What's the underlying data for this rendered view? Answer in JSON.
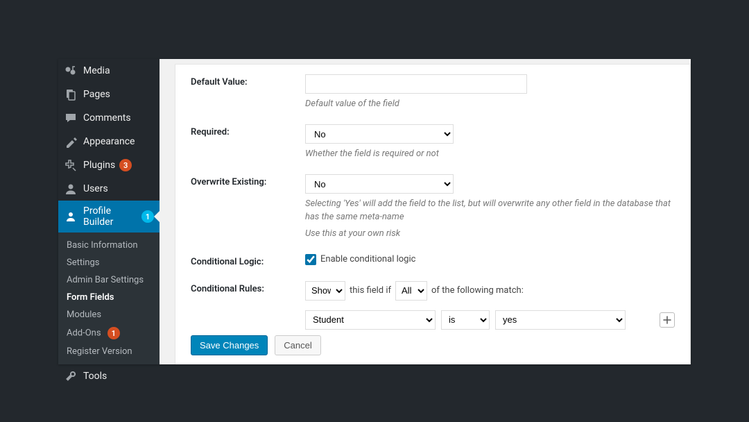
{
  "sidebar": {
    "items": [
      {
        "label": "Media",
        "icon": "media"
      },
      {
        "label": "Pages",
        "icon": "pages"
      },
      {
        "label": "Comments",
        "icon": "comments"
      }
    ],
    "items2": [
      {
        "label": "Appearance",
        "icon": "appearance"
      },
      {
        "label": "Plugins",
        "icon": "plugins",
        "badge": "3",
        "badge_color": "red"
      },
      {
        "label": "Users",
        "icon": "users"
      },
      {
        "label": "Profile Builder",
        "icon": "profile",
        "badge": "1",
        "badge_color": "blue",
        "active": true
      }
    ],
    "submenu": [
      {
        "label": "Basic Information"
      },
      {
        "label": "Settings"
      },
      {
        "label": "Admin Bar Settings"
      },
      {
        "label": "Form Fields",
        "active": true
      },
      {
        "label": "Modules"
      },
      {
        "label": "Add-Ons",
        "badge": "1",
        "badge_color": "red"
      },
      {
        "label": "Register Version"
      }
    ],
    "items3": [
      {
        "label": "Tools",
        "icon": "tools"
      }
    ]
  },
  "form": {
    "default_value": {
      "label": "Default Value:",
      "value": "",
      "desc": "Default value of the field"
    },
    "required": {
      "label": "Required:",
      "value": "No",
      "desc": "Whether the field is required or not"
    },
    "overwrite": {
      "label": "Overwrite Existing:",
      "value": "No",
      "desc": "Selecting 'Yes' will add the field to the list, but will overwrite any other field in the database that has the same meta-name",
      "desc2": "Use this at your own risk"
    },
    "cond_logic": {
      "label": "Conditional Logic:",
      "checkbox_label": "Enable conditional logic",
      "checked": true
    },
    "cond_rules": {
      "label": "Conditional Rules:",
      "action": "Show",
      "t1": "this field if",
      "scope": "All",
      "t2": "of the following match:",
      "rule": {
        "field": "Student",
        "op": "is",
        "value": "yes"
      }
    },
    "save": "Save Changes",
    "cancel": "Cancel"
  }
}
